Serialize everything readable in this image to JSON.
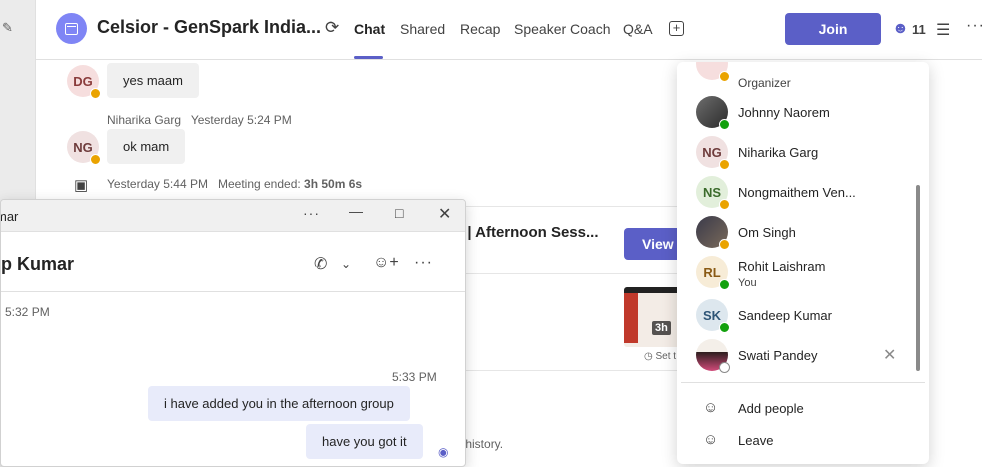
{
  "header": {
    "title": "Celsior - GenSpark India...",
    "tabs": [
      "Chat",
      "Shared",
      "Recap",
      "Speaker Coach",
      "Q&A"
    ],
    "join_label": "Join",
    "participant_count": "11"
  },
  "chat": {
    "messages": [
      {
        "initials": "DG",
        "text": "yes maam"
      },
      {
        "sender": "Niharika Garg",
        "time": "Yesterday 5:24 PM",
        "initials": "NG",
        "text": "ok mam"
      }
    ],
    "meeting_ended": {
      "time": "Yesterday 5:44 PM",
      "label": "Meeting ended:",
      "duration": "3h 50m 6s"
    },
    "card_title": "g | Afternoon Sess...",
    "view_label": "View",
    "thumb_duration": "3h",
    "set_label": "Set t",
    "history_text": "at history."
  },
  "popout": {
    "window_title": "mar",
    "contact_name": "ep Kumar",
    "first_time": "5:32 PM",
    "sent_time": "5:33 PM",
    "sent_messages": [
      "i have added you in the afternoon group",
      "have you got it"
    ]
  },
  "participants": {
    "organizer_label": "Organizer",
    "people": [
      {
        "name": "Johnny Naorem",
        "initials": "",
        "status": "avail",
        "photo": true
      },
      {
        "name": "Niharika Garg",
        "initials": "NG",
        "status": "away",
        "bg": "#f0e1e1",
        "fg": "#6e3b3b"
      },
      {
        "name": "Nongmaithem Ven...",
        "initials": "NS",
        "status": "away",
        "bg": "#e2efdb",
        "fg": "#3b6b2b"
      },
      {
        "name": "Om Singh",
        "initials": "",
        "status": "away",
        "photo": true
      },
      {
        "name": "Rohit Laishram",
        "sub": "You",
        "initials": "RL",
        "status": "avail",
        "bg": "#f7ecd7",
        "fg": "#8a5a14"
      },
      {
        "name": "Sandeep Kumar",
        "initials": "SK",
        "status": "avail",
        "bg": "#dde7ee",
        "fg": "#2f5677"
      },
      {
        "name": "Swati Pandey",
        "initials": "",
        "status": "offline",
        "photo": true
      }
    ],
    "add_people_label": "Add people",
    "leave_label": "Leave"
  }
}
